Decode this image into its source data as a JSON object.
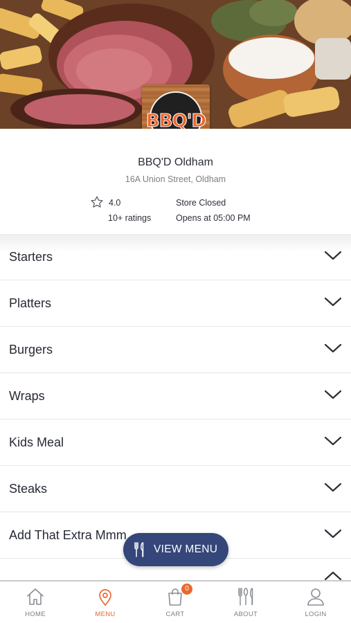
{
  "store": {
    "name": "BBQ'D Oldham",
    "address": "16A Union Street, Oldham",
    "rating": "4.0",
    "rating_count": "10+ ratings",
    "status": "Store Closed",
    "opens": "Opens at 05:00 PM",
    "logo_text": "BBQ'D"
  },
  "categories": [
    {
      "label": "Starters"
    },
    {
      "label": "Platters"
    },
    {
      "label": "Burgers"
    },
    {
      "label": "Wraps"
    },
    {
      "label": "Kids Meal"
    },
    {
      "label": "Steaks"
    },
    {
      "label": "Add That Extra Mmm"
    },
    {
      "label": ""
    }
  ],
  "view_menu": {
    "label": "VIEW MENU",
    "icon": "cutlery-icon"
  },
  "bottom_nav": {
    "items": [
      {
        "label": "HOME",
        "icon": "home-icon"
      },
      {
        "label": "MENU",
        "icon": "location-pin-icon",
        "active": true
      },
      {
        "label": "CART",
        "icon": "shopping-bag-icon",
        "badge": "0"
      },
      {
        "label": "ABOUT",
        "icon": "cutlery-icon"
      },
      {
        "label": "LOGIN",
        "icon": "user-icon"
      }
    ]
  },
  "colors": {
    "accent": "#e8682f",
    "button": "#34467a",
    "text": "#262a34",
    "muted": "#7c7f86"
  }
}
